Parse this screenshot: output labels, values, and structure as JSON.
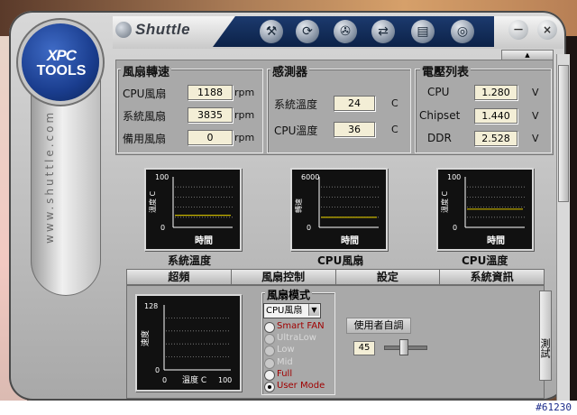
{
  "brand": {
    "name": "Shuttle",
    "badge_line1": "XPC",
    "badge_line2": "TOOLS",
    "side_text": "www.shuttle.com"
  },
  "toolbar": {
    "icons": [
      "tools-icon",
      "refresh-icon",
      "fan-icon",
      "network-icon",
      "disk-icon",
      "lifebuoy-icon"
    ],
    "minimize": "－",
    "close": "×"
  },
  "fan": {
    "title": "風扇轉速",
    "rows": [
      {
        "label": "CPU風扇",
        "value": "1188",
        "unit": "rpm"
      },
      {
        "label": "系統風扇",
        "value": "3835",
        "unit": "rpm"
      },
      {
        "label": "備用風扇",
        "value": "0",
        "unit": "rpm"
      }
    ]
  },
  "sensor": {
    "title": "感測器",
    "rows": [
      {
        "label": "系統溫度",
        "value": "24",
        "unit": "C"
      },
      {
        "label": "CPU溫度",
        "value": "36",
        "unit": "C"
      }
    ]
  },
  "voltage": {
    "title": "電壓列表",
    "rows": [
      {
        "label": "CPU",
        "value": "1.280",
        "unit": "V"
      },
      {
        "label": "Chipset",
        "value": "1.440",
        "unit": "V"
      },
      {
        "label": "DDR",
        "value": "2.528",
        "unit": "V"
      }
    ]
  },
  "charts": [
    {
      "caption": "系統溫度",
      "ylabel": "溫度 C",
      "xlabel": "時間",
      "ymax": "100",
      "ymin": "0"
    },
    {
      "caption": "CPU風扇",
      "ylabel": "轉速",
      "xlabel": "時間",
      "ymax": "6000",
      "ymin": "0"
    },
    {
      "caption": "CPU溫度",
      "ylabel": "溫度 C",
      "xlabel": "時間",
      "ymax": "100",
      "ymin": "0"
    }
  ],
  "tabs": [
    "超頻",
    "風扇控制",
    "設定",
    "系統資訊"
  ],
  "fan_mode": {
    "title": "風扇模式",
    "selected": "CPU風扇",
    "options": [
      {
        "label": "Smart FAN",
        "enabled": true,
        "checked": false
      },
      {
        "label": "UltraLow",
        "enabled": false,
        "checked": false
      },
      {
        "label": "Low",
        "enabled": false,
        "checked": false
      },
      {
        "label": "Mid",
        "enabled": false,
        "checked": false
      },
      {
        "label": "Full",
        "enabled": true,
        "checked": false
      },
      {
        "label": "User Mode",
        "enabled": true,
        "checked": true
      }
    ]
  },
  "curve_chart": {
    "ylabel": "速度",
    "xlabel": "溫度 C",
    "ymax": "128",
    "ymin": "0",
    "xmin": "0",
    "xmax": "100"
  },
  "user_adjust": {
    "label": "使用者自調",
    "value": "45",
    "slider_fraction": 0.45
  },
  "test_button": "測試",
  "watermark": "#61230",
  "colors": {
    "trace": "#c8b400",
    "dots": "#8a8a8a",
    "option_enabled": "#a00000"
  },
  "chart_data": [
    {
      "type": "line",
      "title": "系統溫度",
      "xlabel": "時間",
      "ylabel": "溫度 C",
      "ylim": [
        0,
        100
      ],
      "series": [
        {
          "values": [
            24,
            24,
            24,
            24,
            24,
            24,
            24,
            24,
            24,
            24,
            24,
            24
          ]
        }
      ]
    },
    {
      "type": "line",
      "title": "CPU風扇",
      "xlabel": "時間",
      "ylabel": "轉速",
      "ylim": [
        0,
        6000
      ],
      "series": [
        {
          "values": [
            1188,
            1188,
            1188,
            1188,
            1188,
            1188,
            1188,
            1188,
            1188,
            1188,
            1188,
            1188
          ]
        }
      ]
    },
    {
      "type": "line",
      "title": "CPU溫度",
      "xlabel": "時間",
      "ylabel": "溫度 C",
      "ylim": [
        0,
        100
      ],
      "series": [
        {
          "values": [
            36,
            36,
            36,
            36,
            36,
            36,
            36,
            36,
            36,
            36,
            36,
            36
          ]
        }
      ]
    }
  ]
}
